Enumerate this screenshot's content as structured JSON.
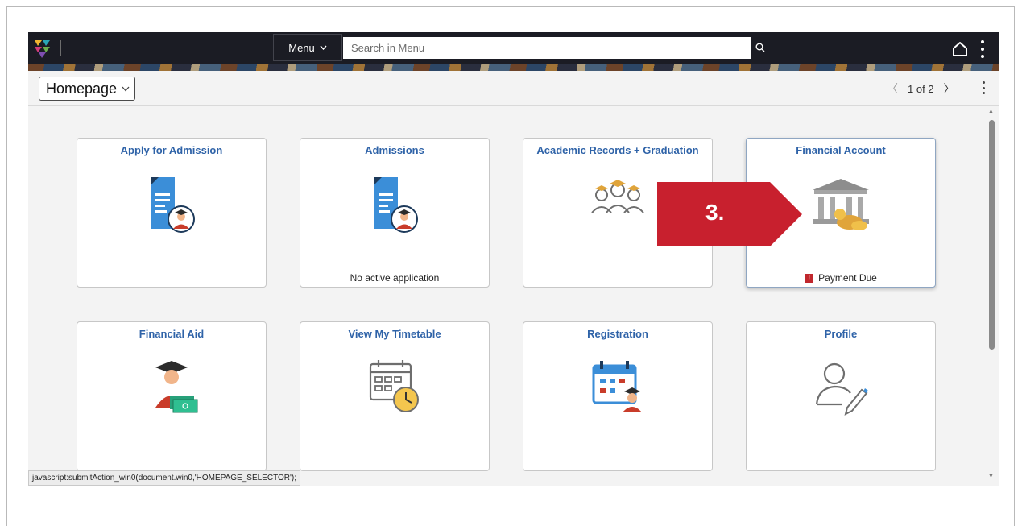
{
  "header": {
    "menu_label": "Menu",
    "search_placeholder": "Search in Menu"
  },
  "pagebar": {
    "homepage_label": "Homepage",
    "pager_text": "1 of 2"
  },
  "tiles": [
    {
      "title": "Apply for Admission",
      "footer": ""
    },
    {
      "title": "Admissions",
      "footer": "No active application"
    },
    {
      "title": "Academic Records + Graduation",
      "footer": ""
    },
    {
      "title": "Financial Account",
      "footer": "Payment Due"
    },
    {
      "title": "Financial Aid",
      "footer": ""
    },
    {
      "title": "View My Timetable",
      "footer": ""
    },
    {
      "title": "Registration",
      "footer": ""
    },
    {
      "title": "Profile",
      "footer": ""
    }
  ],
  "callout": {
    "label": "3.",
    "color": "#c8202e"
  },
  "statusbar": {
    "text": "javascript:submitAction_win0(document.win0,'HOMEPAGE_SELECTOR');"
  },
  "colors": {
    "tile_title": "#2f63a8",
    "alert": "#c0272d",
    "banner": "#1b1c24"
  }
}
